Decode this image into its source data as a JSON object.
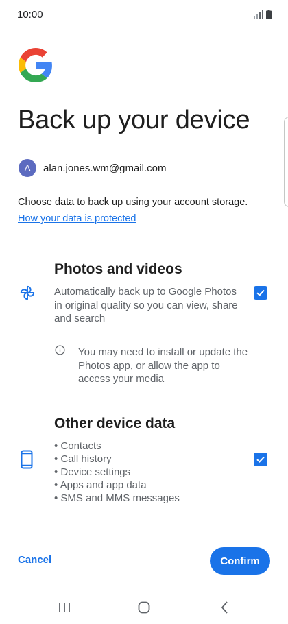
{
  "status_bar": {
    "time": "10:00"
  },
  "header": {
    "title": "Back up your device"
  },
  "account": {
    "avatar_letter": "A",
    "email": "alan.jones.wm@gmail.com"
  },
  "intro": {
    "text": "Choose data to back up using your account storage.",
    "link": "How your data is protected"
  },
  "photos": {
    "title": "Photos and videos",
    "description": "Automatically back up to Google Photos in original quality so you can view, share and search",
    "checked": true,
    "note": "You may need to install or update the Photos app, or allow the app to access your media"
  },
  "device_data": {
    "title": "Other device data",
    "items": [
      "• Contacts",
      "• Call history",
      "• Device settings",
      "• Apps and app data",
      "• SMS and MMS messages"
    ],
    "checked": true
  },
  "actions": {
    "cancel": "Cancel",
    "confirm": "Confirm"
  },
  "colors": {
    "accent": "#1a73e8",
    "avatar": "#5c6bc0"
  }
}
